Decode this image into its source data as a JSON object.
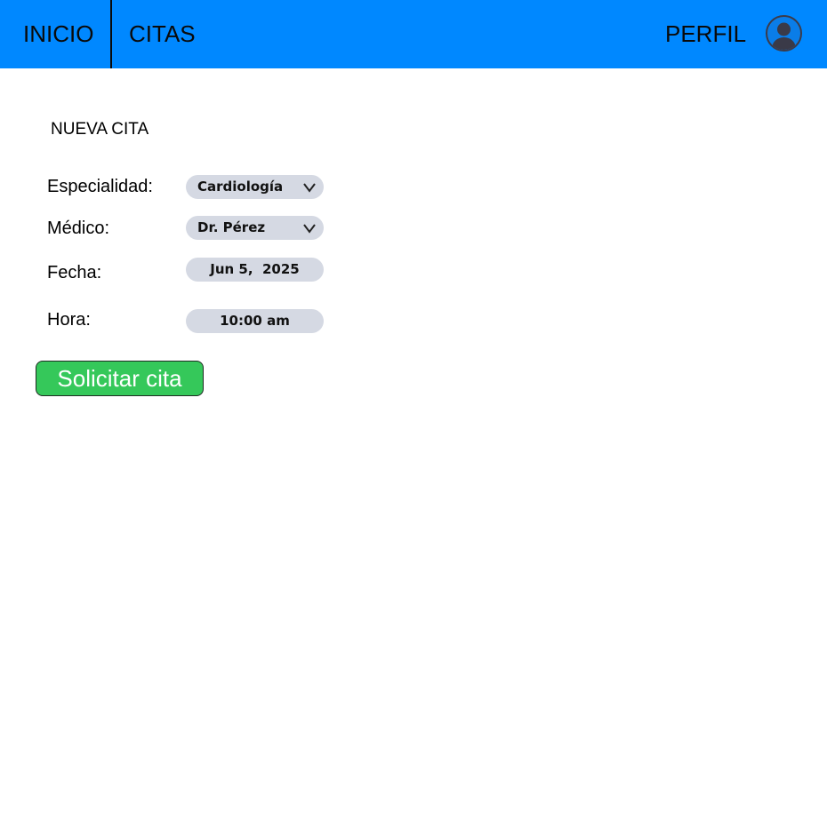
{
  "nav": {
    "inicio_label": "INICIO",
    "citas_label": "CITAS",
    "perfil_label": "PERFIL",
    "avatar_icon": "user-avatar-icon"
  },
  "form": {
    "title": "NUEVA CITA",
    "especialidad": {
      "label": "Especialidad:",
      "value": "Cardiología"
    },
    "medico": {
      "label": "Médico:",
      "value": "Dr. Pérez"
    },
    "fecha": {
      "label": "Fecha:",
      "value": "Jun 5,  2025"
    },
    "hora": {
      "label": "Hora:",
      "value": "10:00 am"
    },
    "submit_label": "Solicitar cita"
  },
  "colors": {
    "navbar": "#0088ff",
    "field_bg": "#d5d9e3",
    "submit_bg": "#35c85a"
  }
}
